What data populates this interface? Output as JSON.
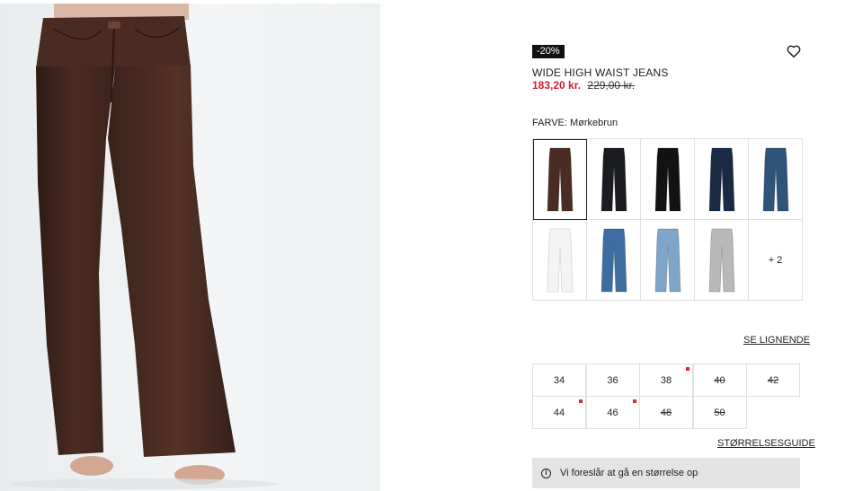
{
  "product": {
    "discount_badge": "-20%",
    "title": "WIDE HIGH WAIST JEANS",
    "price_sale": "183,20 kr.",
    "price_original": "229,00 kr."
  },
  "color": {
    "label": "FARVE: Mørkebrun",
    "swatches": [
      {
        "name": "dark-brown",
        "tone": "#4b2c22",
        "selected": true
      },
      {
        "name": "black-1",
        "tone": "#1a1c22"
      },
      {
        "name": "black-2",
        "tone": "#111214"
      },
      {
        "name": "dark-navy",
        "tone": "#1b2a44"
      },
      {
        "name": "denim-blue",
        "tone": "#2f5478"
      },
      {
        "name": "white",
        "tone": "#f4f4f4"
      },
      {
        "name": "ripped-blue",
        "tone": "#3e6ea1"
      },
      {
        "name": "light-blue",
        "tone": "#7da6c9"
      },
      {
        "name": "light-grey",
        "tone": "#b9b9b9"
      }
    ],
    "more_label": "+ 2"
  },
  "links": {
    "similar": "SE LIGNENDE",
    "size_guide": "STØRRELSESGUIDE"
  },
  "sizes": [
    {
      "label": "34",
      "available": true,
      "low_stock": false
    },
    {
      "label": "36",
      "available": true,
      "low_stock": false
    },
    {
      "label": "38",
      "available": true,
      "low_stock": true
    },
    {
      "label": "40",
      "available": false,
      "low_stock": false
    },
    {
      "label": "42",
      "available": false,
      "low_stock": false
    },
    {
      "label": "44",
      "available": true,
      "low_stock": true
    },
    {
      "label": "46",
      "available": true,
      "low_stock": true
    },
    {
      "label": "48",
      "available": false,
      "low_stock": false
    },
    {
      "label": "50",
      "available": false,
      "low_stock": false
    }
  ],
  "notice": {
    "text": "Vi foreslår at gå en størrelse op"
  },
  "colors": {
    "sale": "#d0212f",
    "badge_bg": "#111111",
    "low_stock_dot": "#e0282f",
    "notice_bg": "#e4e4e4"
  }
}
